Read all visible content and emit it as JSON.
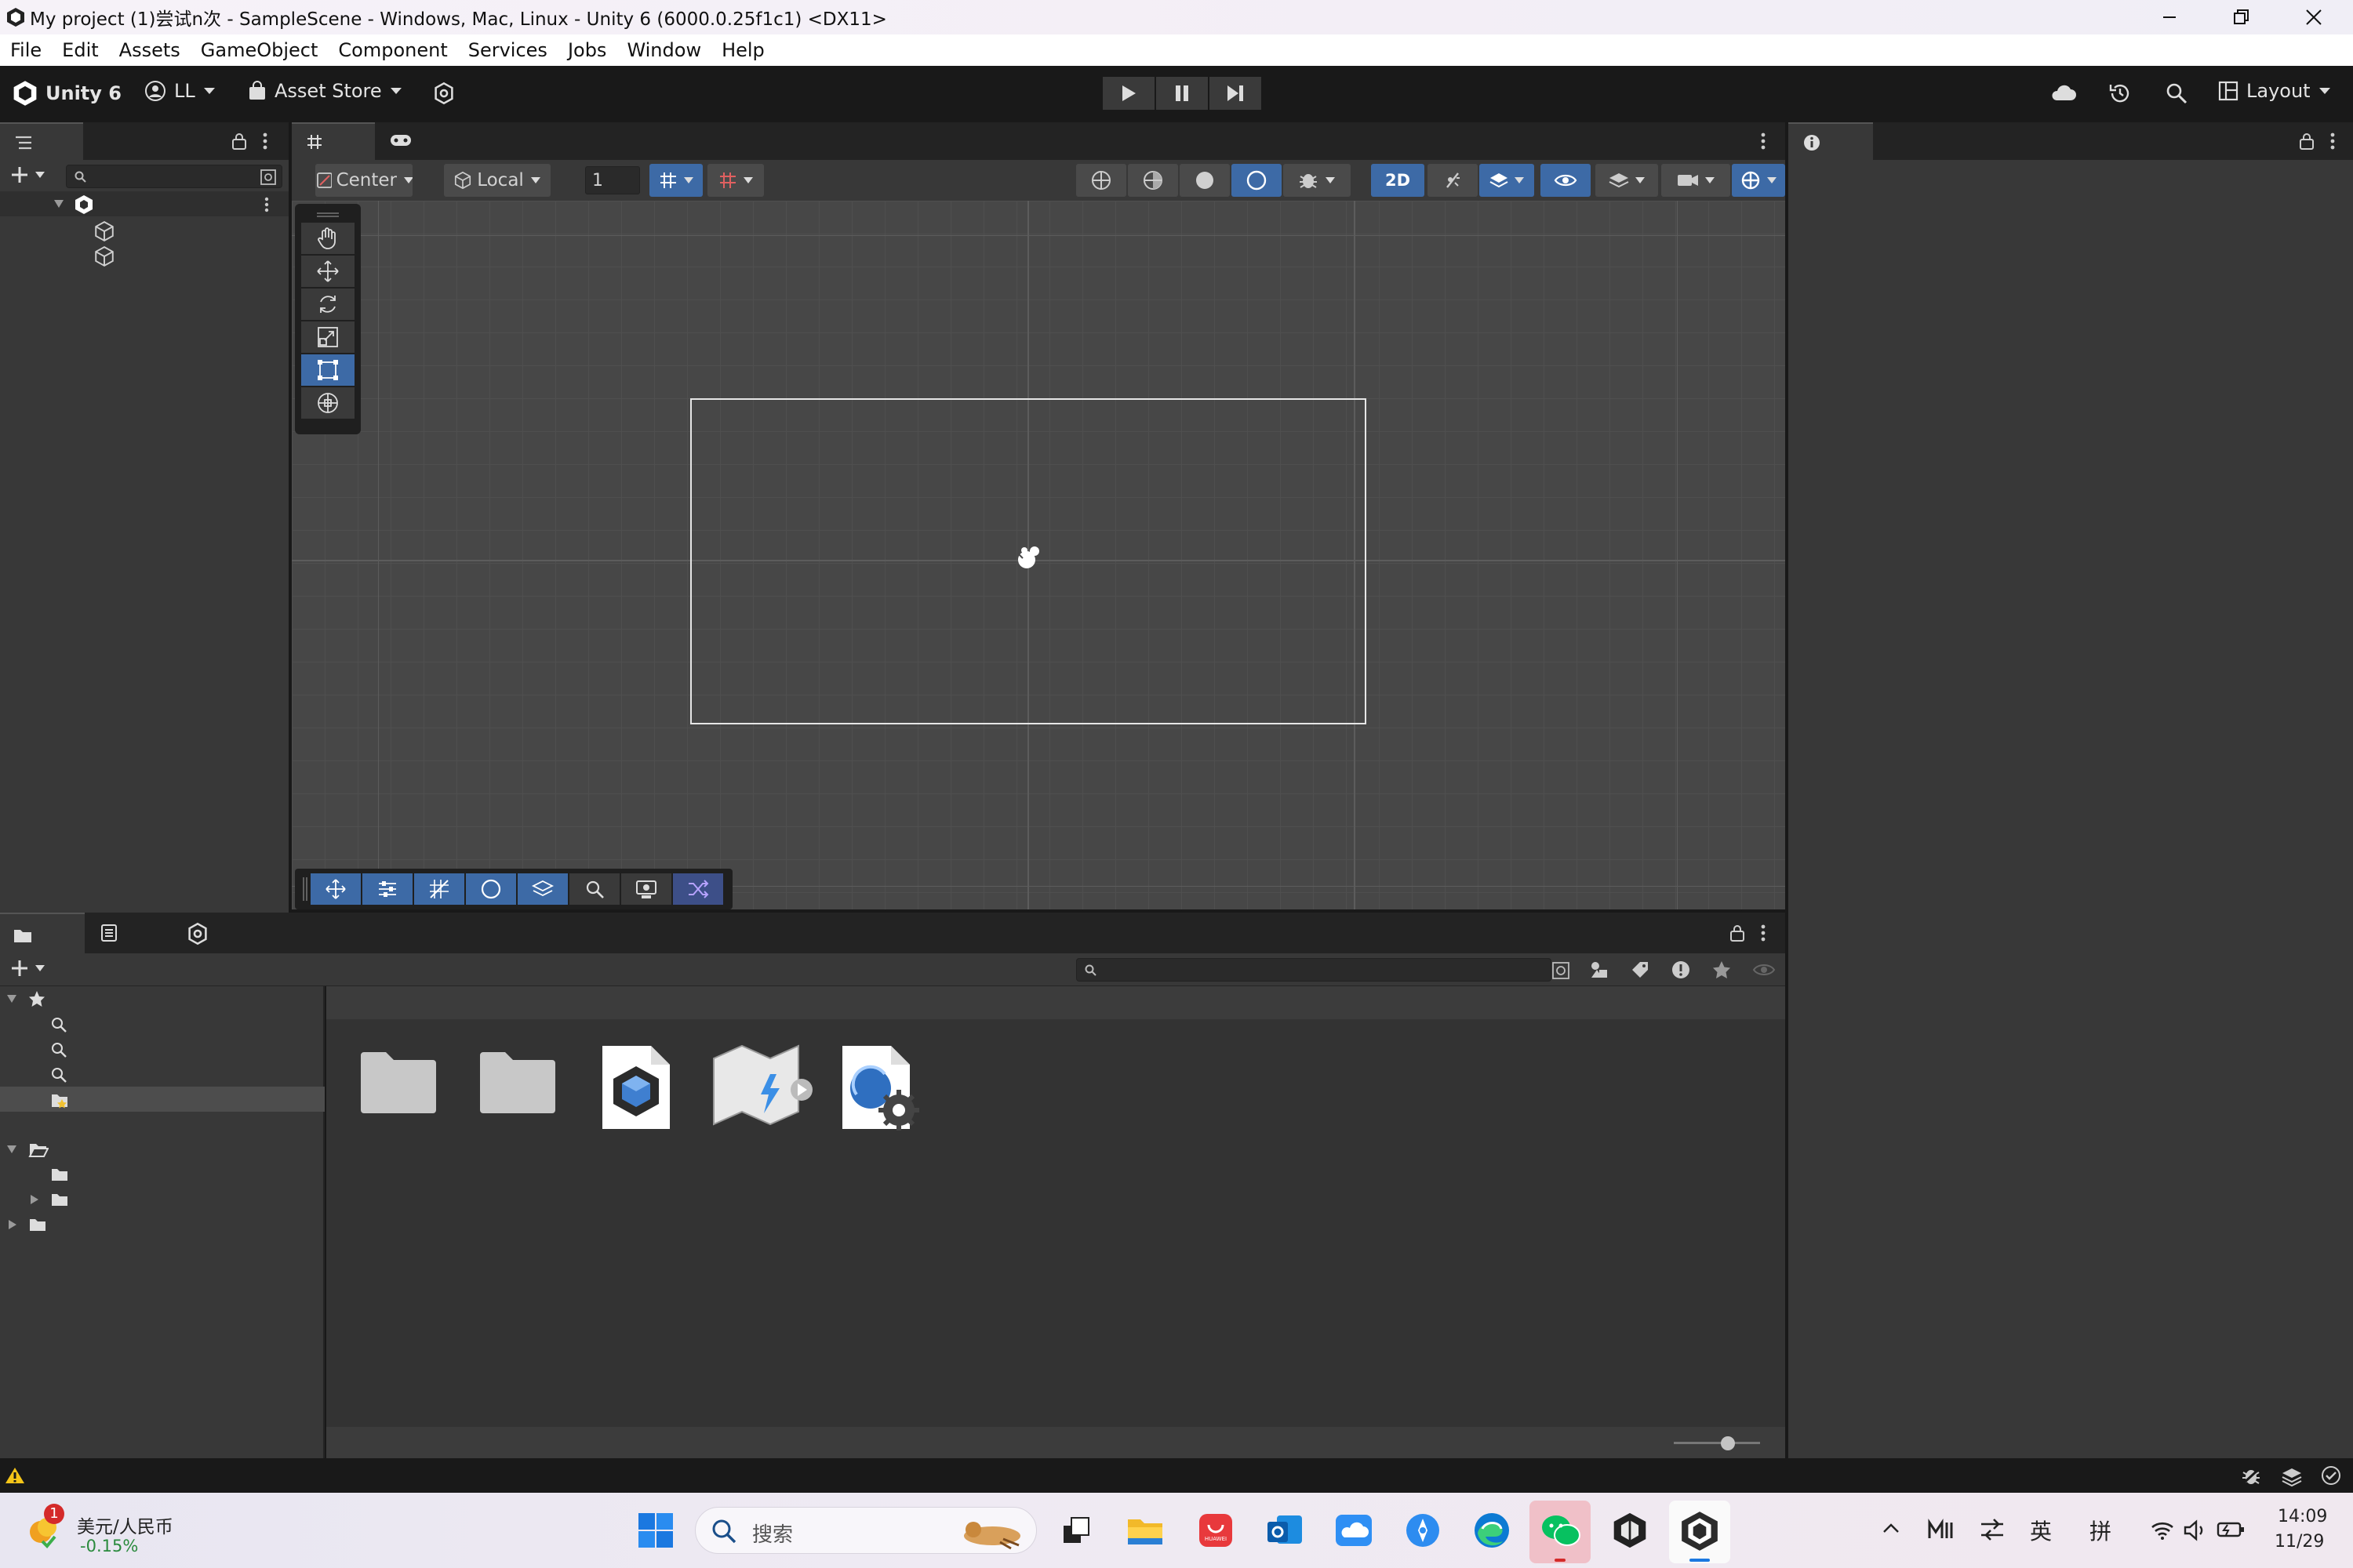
{
  "window": {
    "title": "My project (1)尝试n次 - SampleScene - Windows, Mac, Linux - Unity 6 (6000.0.25f1c1) <DX11>"
  },
  "menu": [
    "File",
    "Edit",
    "Assets",
    "GameObject",
    "Component",
    "Services",
    "Jobs",
    "Window",
    "Help"
  ],
  "toolbar": {
    "product": "Unity 6",
    "account": "LL",
    "asset_store": "Asset Store",
    "layout": "Layout"
  },
  "scene_toolbar": {
    "pivot": "Center",
    "space": "Local",
    "grid_size": "1",
    "mode_2d": "2D"
  },
  "taskbar": {
    "widget_title": "美元/人民币",
    "widget_change": "-0.15%",
    "widget_badge": "1",
    "search_placeholder": "搜索",
    "ime_lang": "英",
    "ime_mode": "拼",
    "time": "14:09",
    "date": "11/29"
  },
  "colors": {
    "accent": "#3d6aa6",
    "panel": "#383838",
    "scene": "#474747",
    "warning": "#f5c518",
    "edge": "#0c7ad3",
    "wechat": "#07c160"
  }
}
